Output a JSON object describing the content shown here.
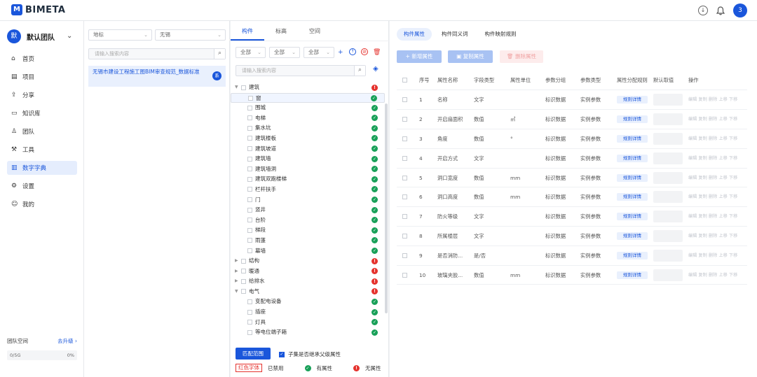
{
  "app": {
    "logo_mark": "M",
    "logo_text": "BIMETA",
    "user_avatar": "3"
  },
  "team": {
    "avatar": "默",
    "name": "默认团队"
  },
  "nav": [
    {
      "label": "首页",
      "icon": "home-icon"
    },
    {
      "label": "项目",
      "icon": "project-icon"
    },
    {
      "label": "分享",
      "icon": "share-icon"
    },
    {
      "label": "知识库",
      "icon": "knowledge-icon"
    },
    {
      "label": "团队",
      "icon": "team-icon"
    },
    {
      "label": "工具",
      "icon": "tools-icon"
    },
    {
      "label": "数字字典",
      "icon": "dictionary-icon",
      "active": true
    },
    {
      "label": "设置",
      "icon": "settings-icon"
    },
    {
      "label": "我的",
      "icon": "profile-icon"
    }
  ],
  "space": {
    "label": "团队空间",
    "upgrade": "去升级 ›",
    "usage": "0/5G",
    "percent": "0%"
  },
  "standards": {
    "filter1": "地标",
    "filter2": "无锡",
    "search_placeholder": "请输入搜索内容",
    "item_title": "无锡市建设工程施工图BIM审查规范_数据标准",
    "item_badge": "系"
  },
  "tree_panel": {
    "tabs": [
      "构件",
      "标高",
      "空间"
    ],
    "filters": [
      "全部",
      "全部",
      "全部"
    ],
    "search_placeholder": "请输入搜索内容",
    "nodes": [
      {
        "label": "建筑",
        "level": 0,
        "expanded": true,
        "status": "no"
      },
      {
        "label": "窗",
        "level": 1,
        "status": "ok",
        "selected": true
      },
      {
        "label": "围城",
        "level": 1,
        "status": "ok"
      },
      {
        "label": "电梯",
        "level": 1,
        "status": "ok"
      },
      {
        "label": "集水坑",
        "level": 1,
        "status": "ok"
      },
      {
        "label": "建筑楼板",
        "level": 1,
        "status": "ok"
      },
      {
        "label": "建筑坡道",
        "level": 1,
        "status": "ok"
      },
      {
        "label": "建筑墙",
        "level": 1,
        "status": "ok"
      },
      {
        "label": "建筑墙洞",
        "level": 1,
        "status": "ok"
      },
      {
        "label": "建筑双跑楼梯",
        "level": 1,
        "status": "ok"
      },
      {
        "label": "栏杆扶手",
        "level": 1,
        "status": "ok"
      },
      {
        "label": "门",
        "level": 1,
        "status": "ok"
      },
      {
        "label": "竖井",
        "level": 1,
        "status": "ok"
      },
      {
        "label": "台阶",
        "level": 1,
        "status": "ok"
      },
      {
        "label": "梯段",
        "level": 1,
        "status": "ok"
      },
      {
        "label": "雨蓬",
        "level": 1,
        "status": "ok"
      },
      {
        "label": "幕墙",
        "level": 1,
        "status": "ok"
      },
      {
        "label": "结构",
        "level": 0,
        "expanded": false,
        "status": "no"
      },
      {
        "label": "暖通",
        "level": 0,
        "expanded": false,
        "status": "no"
      },
      {
        "label": "给排水",
        "level": 0,
        "expanded": false,
        "status": "no"
      },
      {
        "label": "电气",
        "level": 0,
        "expanded": true,
        "status": "no"
      },
      {
        "label": "变配电设备",
        "level": 1,
        "status": "ok"
      },
      {
        "label": "插座",
        "level": 1,
        "status": "ok"
      },
      {
        "label": "灯具",
        "level": 1,
        "status": "ok"
      },
      {
        "label": "等电位端子箱",
        "level": 1,
        "status": "ok"
      }
    ],
    "match_button": "匹配范围",
    "inherit_label": "子集是否继承父级属性",
    "legend_red": "红色字体",
    "legend_disabled": "已禁用",
    "legend_has": "有属性",
    "legend_none": "无属性"
  },
  "attributes": {
    "tabs": [
      "构件属性",
      "构件同义词",
      "构件映射规则"
    ],
    "add_button": "+ 新增属性",
    "copy_button": "复制属性",
    "delete_button": "删除属性",
    "columns": [
      "序号",
      "属性名称",
      "字段类型",
      "属性单位",
      "参数分组",
      "参数类型",
      "属性分配规则",
      "默认取值",
      "操作"
    ],
    "rule_label": "规则详情",
    "ops_label": "编辑 复制 删除 上移 下移",
    "rows": [
      {
        "no": "1",
        "name": "名称",
        "type": "文字",
        "unit": "",
        "group": "标识数据",
        "ptype": "实例参数"
      },
      {
        "no": "2",
        "name": "开启扇面积",
        "type": "数值",
        "unit": "㎡",
        "group": "标识数据",
        "ptype": "实例参数"
      },
      {
        "no": "3",
        "name": "角度",
        "type": "数值",
        "unit": "°",
        "group": "标识数据",
        "ptype": "实例参数"
      },
      {
        "no": "4",
        "name": "开启方式",
        "type": "文字",
        "unit": "",
        "group": "标识数据",
        "ptype": "实例参数"
      },
      {
        "no": "5",
        "name": "洞口宽度",
        "type": "数值",
        "unit": "mm",
        "group": "标识数据",
        "ptype": "实例参数"
      },
      {
        "no": "6",
        "name": "洞口高度",
        "type": "数值",
        "unit": "mm",
        "group": "标识数据",
        "ptype": "实例参数"
      },
      {
        "no": "7",
        "name": "防火等级",
        "type": "文字",
        "unit": "",
        "group": "标识数据",
        "ptype": "实例参数"
      },
      {
        "no": "8",
        "name": "所属楼层",
        "type": "文字",
        "unit": "",
        "group": "标识数据",
        "ptype": "实例参数"
      },
      {
        "no": "9",
        "name": "是否消防...",
        "type": "是/否",
        "unit": "",
        "group": "标识数据",
        "ptype": "实例参数"
      },
      {
        "no": "10",
        "name": "玻璃夹胶...",
        "type": "数值",
        "unit": "mm",
        "group": "标识数据",
        "ptype": "实例参数"
      }
    ]
  },
  "colors": {
    "primary": "#1a56db",
    "ok": "#18a058",
    "error": "#e5322d"
  }
}
